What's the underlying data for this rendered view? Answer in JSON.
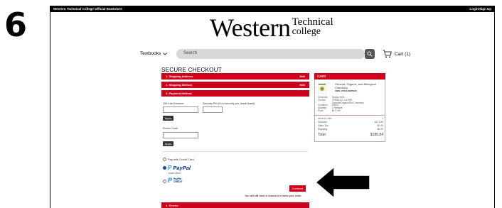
{
  "step_number": "6",
  "topbar": {
    "store_name": "Western Technical College Official Bookstore",
    "login": "Login/Sign Up"
  },
  "logo": {
    "main": "Western",
    "side_top": "Technical",
    "side_bottom": "college"
  },
  "nav": {
    "textbooks_label": "Textbooks",
    "search_placeholder": "Search",
    "cart_label": "Cart (1)"
  },
  "checkout": {
    "title": "SECURE CHECKOUT",
    "steps": [
      {
        "label": "1. Shipping Address",
        "action": "Edit"
      },
      {
        "label": "2. Shipping Method",
        "action": "Edit"
      },
      {
        "label": "3. Payment Method",
        "action": ""
      }
    ],
    "gift_card_label": "Gift Card Number",
    "security_pin_label": "Security PIN (if no security pin, leave blank)",
    "apply_label": "Apply",
    "promo_label": "Promo Code",
    "pay_credit_label": "Pay with Credit Card",
    "paypal_label": "PayPal",
    "paypal_learn": "Learn More",
    "paypal_credit_top": "PayPal",
    "paypal_credit_bottom": "CREDIT",
    "continue_label": "Continue",
    "review_note": "You will still have a chance to review your order.",
    "review_step": "4. Review"
  },
  "cart": {
    "header": "CART",
    "book_title_1": "General, Organic, and Biological",
    "book_title_2": "Chemistry",
    "book_isbn": "ISBN: 9781319086046",
    "meta": [
      {
        "k": "Semester:",
        "v": "Spring 2023"
      },
      {
        "k": "Course:",
        "v": "CHEM-107-4 57981"
      },
      {
        "k": "",
        "v": "General/Organic/Biol Chemistry"
      },
      {
        "k": "Condition:",
        "v": "USED"
      },
      {
        "k": "Quantity:",
        "v": "1 Remove"
      },
      {
        "k": "Price:",
        "v": "$177.59"
      }
    ],
    "items_label": "Items in Cart:",
    "items_value": "1",
    "subtotal_label": "Subtotal:",
    "subtotal_value": "$177.59",
    "tax_label": "Sales Tax:",
    "tax_value": "$0.00",
    "shipping_label": "Shipping:",
    "shipping_value": "$8.25",
    "total_label": "Total:",
    "total_value": "$185.84"
  },
  "colors": {
    "accent": "#d0021b",
    "topbar": "#000000",
    "paypal_blue": "#003087"
  },
  "icons": [
    "chevron-down-icon",
    "search-icon",
    "cart-icon",
    "book-cover-icon",
    "arrow-left-icon"
  ]
}
